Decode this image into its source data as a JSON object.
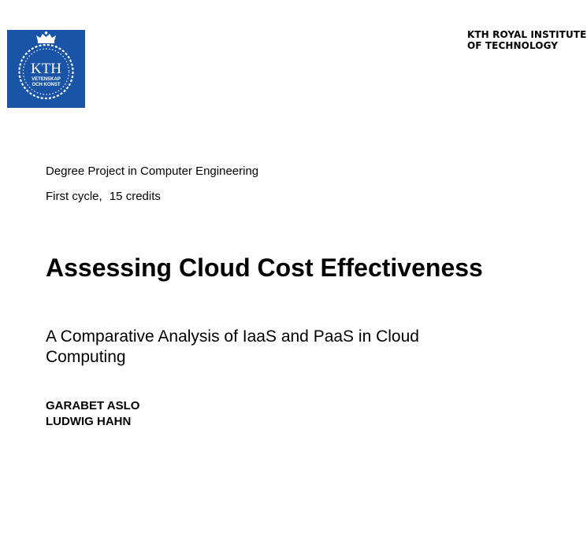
{
  "logo": {
    "text_main": "KTH",
    "text_line1": "VETENSKAP",
    "text_line2": "OCH KONST",
    "background_color": "#1954a6",
    "icon": "kth-crown-seal-icon"
  },
  "institute": {
    "line1": "KTH ROYAL INSTITUTE",
    "line2": "OF TECHNOLOGY"
  },
  "degree_project": "Degree Project in Computer Engineering",
  "cycle": {
    "level": "First cycle,",
    "credits": "15 credits"
  },
  "title": "Assessing Cloud Cost Effectiveness",
  "subtitle": "A Comparative Analysis of IaaS and PaaS in Cloud Computing",
  "authors": [
    "GARABET ASLO",
    "LUDWIG HAHN"
  ]
}
